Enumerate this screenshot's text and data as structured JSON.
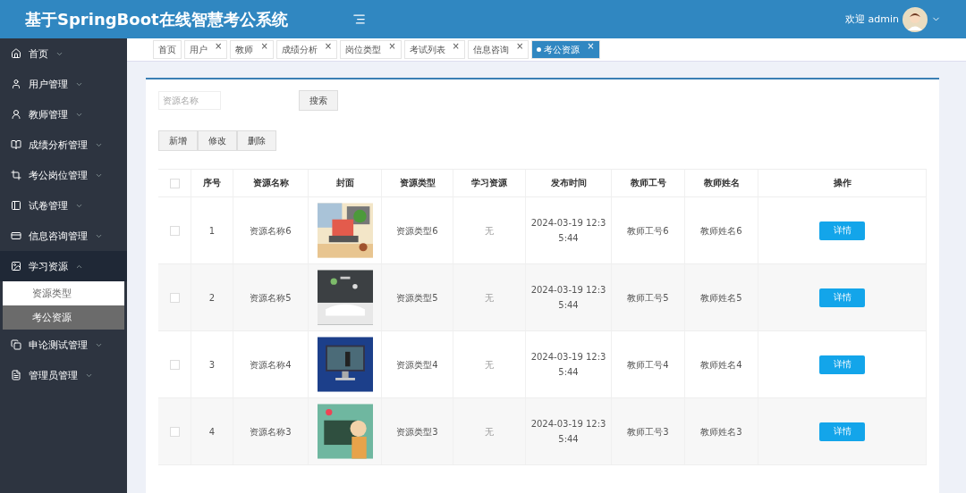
{
  "header": {
    "title": "基于SpringBoot在线智慧考公系统",
    "greeting": "欢迎 admin"
  },
  "sidebar": {
    "items": [
      {
        "label": "首页",
        "expanded": false
      },
      {
        "label": "用户管理",
        "expanded": false
      },
      {
        "label": "教师管理",
        "expanded": false
      },
      {
        "label": "成绩分析管理",
        "expanded": false
      },
      {
        "label": "考公岗位管理",
        "expanded": false
      },
      {
        "label": "试卷管理",
        "expanded": false
      },
      {
        "label": "信息咨询管理",
        "expanded": false
      },
      {
        "label": "学习资源",
        "expanded": true,
        "children": [
          {
            "label": "资源类型",
            "selected": false
          },
          {
            "label": "考公资源",
            "selected": true
          }
        ]
      },
      {
        "label": "申论测试管理",
        "expanded": false
      },
      {
        "label": "管理员管理",
        "expanded": false
      }
    ]
  },
  "tabs": [
    {
      "label": "首页",
      "closable": false,
      "selected": false
    },
    {
      "label": "用户",
      "closable": true,
      "selected": false
    },
    {
      "label": "教师",
      "closable": true,
      "selected": false
    },
    {
      "label": "成绩分析",
      "closable": true,
      "selected": false
    },
    {
      "label": "岗位类型",
      "closable": true,
      "selected": false
    },
    {
      "label": "考试列表",
      "closable": true,
      "selected": false
    },
    {
      "label": "信息咨询",
      "closable": true,
      "selected": false
    },
    {
      "label": "考公资源",
      "closable": true,
      "selected": true
    }
  ],
  "close_glyph": "×",
  "search": {
    "placeholder": "资源名称",
    "button": "搜索"
  },
  "actions": [
    "新增",
    "修改",
    "删除"
  ],
  "table": {
    "all_checked": false,
    "columns": [
      "序号",
      "资源名称",
      "封面",
      "资源类型",
      "学习资源",
      "发布时间",
      "教师工号",
      "教师姓名",
      "操作"
    ],
    "rows": [
      {
        "checked": false,
        "index": "1",
        "name": "资源名称6",
        "type": "资源类型6",
        "resource": "无",
        "time": "2024-03-19 12:35:44",
        "teacher_no": "教师工号6",
        "teacher_name": "教师姓名6",
        "action": "详情"
      },
      {
        "checked": false,
        "index": "2",
        "name": "资源名称5",
        "type": "资源类型5",
        "resource": "无",
        "time": "2024-03-19 12:35:44",
        "teacher_no": "教师工号5",
        "teacher_name": "教师姓名5",
        "action": "详情"
      },
      {
        "checked": false,
        "index": "3",
        "name": "资源名称4",
        "type": "资源类型4",
        "resource": "无",
        "time": "2024-03-19 12:35:44",
        "teacher_no": "教师工号4",
        "teacher_name": "教师姓名4",
        "action": "详情"
      },
      {
        "checked": false,
        "index": "4",
        "name": "资源名称3",
        "type": "资源类型3",
        "resource": "无",
        "time": "2024-03-19 12:35:44",
        "teacher_no": "教师工号3",
        "teacher_name": "教师姓名3",
        "action": "详情"
      }
    ]
  }
}
